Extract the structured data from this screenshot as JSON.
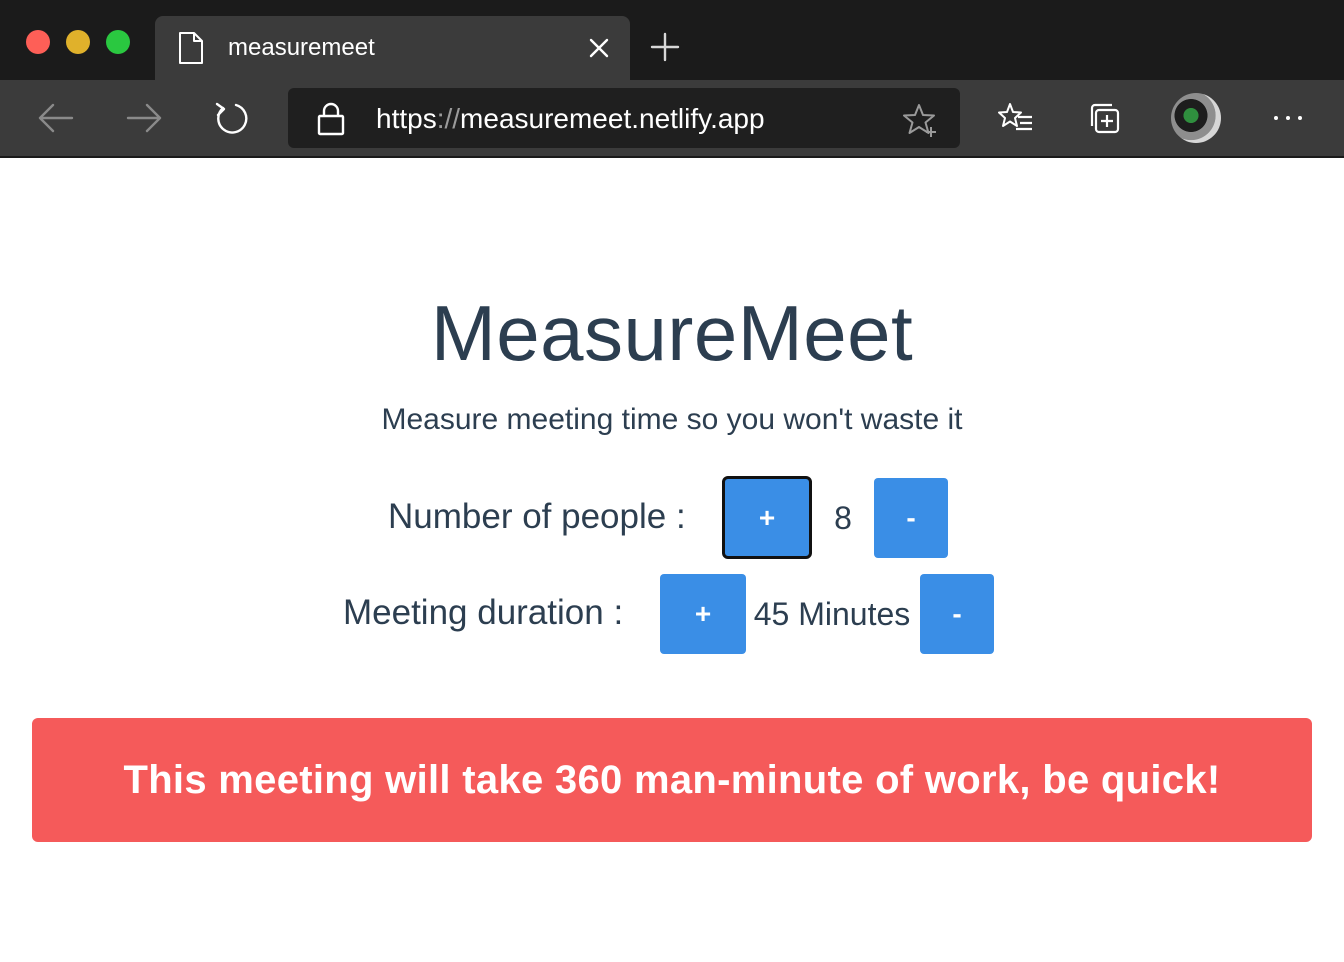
{
  "browser": {
    "tab": {
      "title": "measuremeet"
    },
    "address": {
      "scheme": "https",
      "separator": "://",
      "host": "measuremeet.netlify.app"
    },
    "toolbar_icons": [
      "back-arrow-icon",
      "forward-arrow-icon",
      "reload-icon",
      "lock-icon",
      "add-favorite-star-icon",
      "favorites-list-icon",
      "collections-icon",
      "profile-avatar",
      "more-menu-icon"
    ]
  },
  "app": {
    "title": "MeasureMeet",
    "subtitle": "Measure meeting time so you won't waste it",
    "people": {
      "label": "Number of people :",
      "increment_label": "+",
      "value": "8",
      "decrement_label": "-"
    },
    "duration": {
      "label": "Meeting duration :",
      "increment_label": "+",
      "value": "45 Minutes",
      "decrement_label": "-"
    },
    "alert": {
      "text": "This meeting will take 360 man-minute of work, be quick!"
    }
  },
  "colors": {
    "accent": "#3a8ee6",
    "alert": "#f55a5a",
    "text": "#2c3e50",
    "chrome_dark": "#1b1b1b",
    "chrome_mid": "#3b3b3b"
  }
}
